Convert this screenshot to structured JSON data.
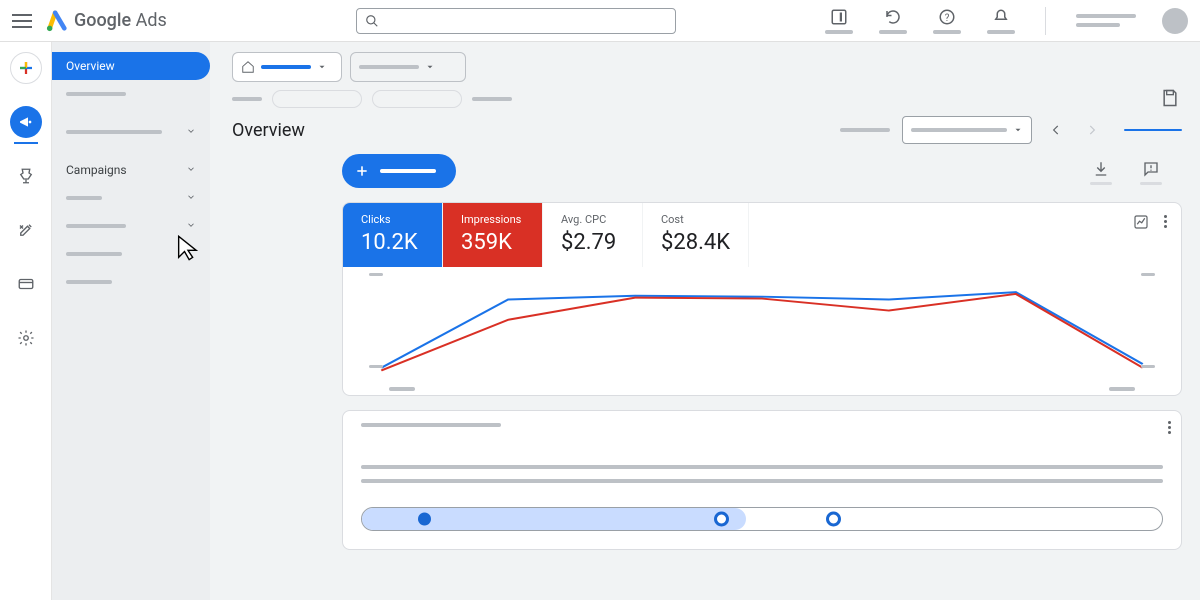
{
  "header": {
    "product": "Google",
    "product_suffix": "Ads"
  },
  "sidebar": {
    "items": [
      {
        "label": "Overview",
        "active": true
      },
      {
        "label": "Campaigns",
        "active": false
      }
    ]
  },
  "page": {
    "title": "Overview"
  },
  "metrics": [
    {
      "key": "clicks",
      "label": "Clicks",
      "value": "10.2K",
      "color": "blue"
    },
    {
      "key": "impressions",
      "label": "Impressions",
      "value": "359K",
      "color": "red"
    },
    {
      "key": "avg_cpc",
      "label": "Avg. CPC",
      "value": "$2.79",
      "color": "plain"
    },
    {
      "key": "cost",
      "label": "Cost",
      "value": "$28.4K",
      "color": "plain"
    }
  ],
  "chart_data": {
    "type": "line",
    "title": "",
    "xlabel": "",
    "ylabel": "",
    "x": [
      0,
      1,
      2,
      3,
      4,
      5,
      6
    ],
    "series": [
      {
        "name": "Clicks",
        "color": "#1a73e8",
        "values": [
          8,
          82,
          86,
          85,
          82,
          90,
          12
        ]
      },
      {
        "name": "Impressions",
        "color": "#d93025",
        "values": [
          5,
          60,
          84,
          83,
          70,
          88,
          8
        ]
      }
    ],
    "ylim": [
      0,
      100
    ]
  },
  "timeline": {
    "fill_pct": 48,
    "markers_pct": [
      7,
      44,
      58
    ]
  }
}
